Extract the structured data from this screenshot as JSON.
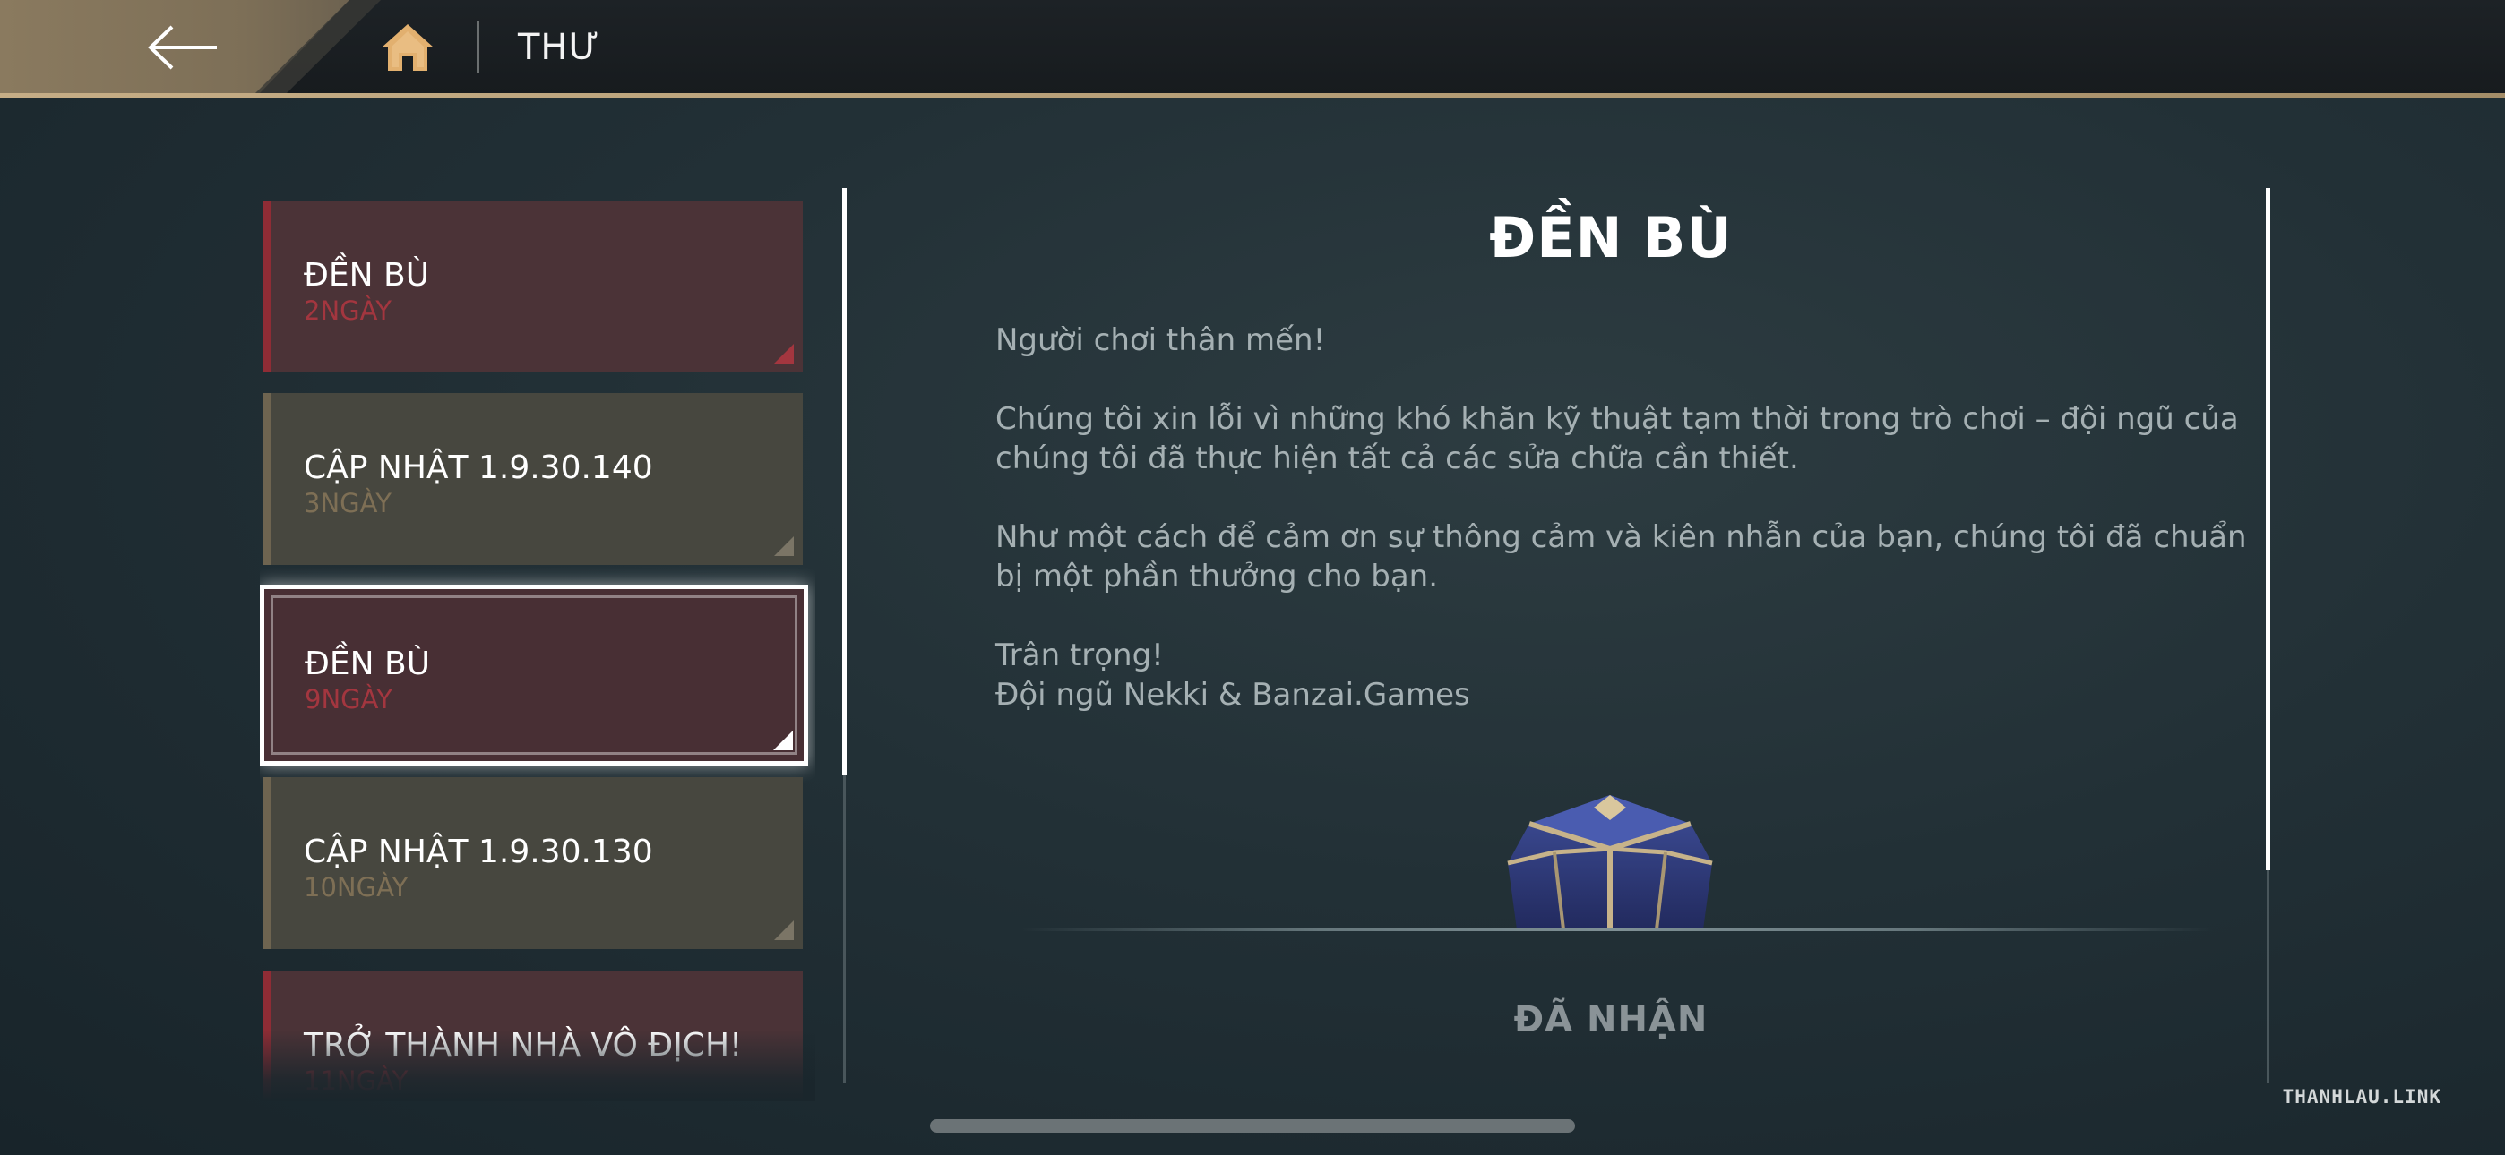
{
  "header": {
    "title": "THƯ"
  },
  "mail_list": {
    "items": [
      {
        "title": "ĐỀN BÙ",
        "age": "2NGÀY",
        "type": "red",
        "selected": false
      },
      {
        "title": "CẬP NHẬT 1.9.30.140",
        "age": "3NGÀY",
        "type": "olive",
        "selected": false
      },
      {
        "title": "ĐỀN BÙ",
        "age": "9NGÀY",
        "type": "red",
        "selected": true
      },
      {
        "title": "CẬP NHẬT 1.9.30.130",
        "age": "10NGÀY",
        "type": "olive",
        "selected": false
      },
      {
        "title": "TRỞ THÀNH NHÀ VÔ ĐỊCH!",
        "age": "11NGÀY",
        "type": "red",
        "selected": false
      }
    ]
  },
  "message": {
    "title": "ĐỀN BÙ",
    "greeting": "Người chơi thân mến!",
    "paragraph1": "Chúng tôi xin lỗi vì những khó khăn kỹ thuật tạm thời trong trò chơi – đội ngũ của chúng tôi đã thực hiện tất cả các sửa chữa cần thiết.",
    "paragraph2": "Như một cách để cảm ơn sự thông cảm và kiên nhẫn của bạn, chúng tôi đã chuẩn bị một phần thưởng cho bạn.",
    "closing": "Trân trọng!",
    "signature": "Đội ngũ Nekki & Banzai.Games",
    "reward_status": "ĐÃ NHẬN"
  },
  "watermark": "THANHLAU.LINK",
  "colors": {
    "accent_gold": "#c5ad86",
    "mail_red": "#8f2c35",
    "mail_olive": "#6e6450"
  }
}
